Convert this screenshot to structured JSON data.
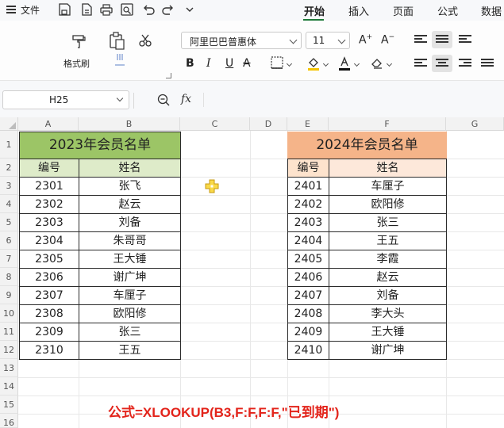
{
  "menubar": {
    "file_label": "文件",
    "tabs": [
      {
        "label": "开始",
        "active": true
      },
      {
        "label": "插入",
        "active": false
      },
      {
        "label": "页面",
        "active": false
      },
      {
        "label": "公式",
        "active": false
      },
      {
        "label": "数据",
        "active": false
      }
    ],
    "accent_color": "#1f7a3a"
  },
  "ribbon": {
    "format_painter_label": "格式刷",
    "font_name": "阿里巴巴普惠体",
    "font_size": "11"
  },
  "formula_bar": {
    "cell_ref": "H25",
    "fx_label": "fx",
    "formula": ""
  },
  "grid": {
    "columns": [
      "A",
      "B",
      "C",
      "D",
      "E",
      "F",
      "G"
    ],
    "rows": [
      "1",
      "2",
      "3",
      "4",
      "5",
      "6",
      "7",
      "8",
      "9",
      "10",
      "11",
      "12",
      "13",
      "14",
      "15",
      "16"
    ]
  },
  "table_2023": {
    "title": "2023年会员名单",
    "header_id": "编号",
    "header_name": "姓名",
    "title_color": "#9cc566",
    "header_color": "#deebc9",
    "rows": [
      {
        "id": "2301",
        "name": "张飞"
      },
      {
        "id": "2302",
        "name": "赵云"
      },
      {
        "id": "2303",
        "name": "刘备"
      },
      {
        "id": "2304",
        "name": "朱哥哥"
      },
      {
        "id": "2305",
        "name": "王大锤"
      },
      {
        "id": "2306",
        "name": "谢广坤"
      },
      {
        "id": "2307",
        "name": "车厘子"
      },
      {
        "id": "2308",
        "name": "欧阳修"
      },
      {
        "id": "2309",
        "name": "张三"
      },
      {
        "id": "2310",
        "name": "王五"
      }
    ]
  },
  "table_2024": {
    "title": "2024年会员名单",
    "header_id": "编号",
    "header_name": "姓名",
    "title_color": "#f5b489",
    "header_color": "#fde3cd",
    "rows": [
      {
        "id": "2401",
        "name": "车厘子"
      },
      {
        "id": "2402",
        "name": "欧阳修"
      },
      {
        "id": "2403",
        "name": "张三"
      },
      {
        "id": "2404",
        "name": "王五"
      },
      {
        "id": "2405",
        "name": "李霞"
      },
      {
        "id": "2406",
        "name": "赵云"
      },
      {
        "id": "2407",
        "name": "刘备"
      },
      {
        "id": "2408",
        "name": "李大头"
      },
      {
        "id": "2409",
        "name": "王大锤"
      },
      {
        "id": "2410",
        "name": "谢广坤"
      }
    ]
  },
  "caption": {
    "text": "公式=XLOOKUP(B3,F:F,F:F,\"已到期\")",
    "color": "#e3241b"
  },
  "icons": [
    "menu-icon",
    "save-icon",
    "export-pdf-icon",
    "print-icon",
    "preview-icon",
    "undo-icon",
    "redo-icon",
    "chevron-down-icon",
    "format-painter-icon",
    "paste-icon",
    "cut-icon",
    "zoom-icon",
    "cursor-plus-icon"
  ]
}
